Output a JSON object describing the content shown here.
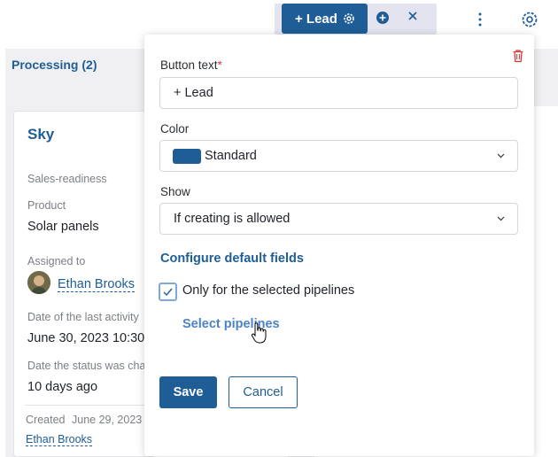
{
  "toolbar": {
    "lead_button_label": "+ Lead",
    "icons": [
      "gear-icon",
      "plus-circle-icon",
      "close-icon",
      "more-vertical-icon",
      "settings-icon"
    ]
  },
  "column": {
    "title": "Processing (2)"
  },
  "card": {
    "title": "Sky",
    "sales_readiness_label": "Sales-readiness",
    "product_label": "Product",
    "product_value": "Solar panels",
    "assigned_label": "Assigned to",
    "assigned_name": "Ethan Brooks",
    "last_activity_label": "Date of the last activity",
    "last_activity_value": "June 30, 2023 10:30",
    "status_changed_label": "Date the status was chan",
    "status_changed_value": "10 days ago",
    "created_label": "Created",
    "created_date": "June 29, 2023",
    "created_by": "Ethan Brooks"
  },
  "popup": {
    "button_text_label": "Button text",
    "required_mark": "*",
    "button_text_value": "+ Lead",
    "color_label": "Color",
    "color_value": "Standard",
    "color_swatch": "#1f5d96",
    "show_label": "Show",
    "show_value": "If creating is allowed",
    "configure_link": "Configure default fields",
    "only_selected_label": "Only for the selected pipelines",
    "only_selected_checked": true,
    "select_pipelines_link": "Select pipelines",
    "save_label": "Save",
    "cancel_label": "Cancel"
  },
  "colors": {
    "primary": "#1f5d96",
    "danger": "#d63b3b",
    "link_light": "#4a83c8"
  }
}
